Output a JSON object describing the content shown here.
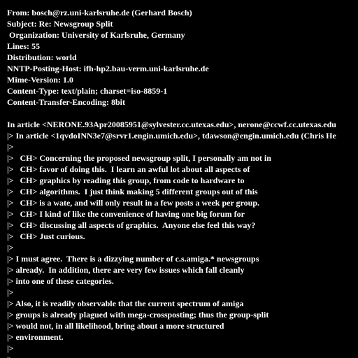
{
  "message": {
    "lines": [
      "From: bosch@rz.uni-karlsruhe.de (Gerhard Bosch)",
      "Subject: Re: Newsgroup Split",
      " Organization: University of Karlsruhe, Germany",
      "Lines: 55",
      "Distribution: world",
      "NNTP-Posting-Host: ifh-hp2.bau-verm.uni-karlsruhe.de",
      "Mime-Version: 1.0",
      "Content-Type: text/plain; charset=iso-8859-1",
      "Content-Transfer-Encoding: 8bit",
      "",
      "In article <NERONE.93Apr20085951@sylvester.cc.utexas.edu>, nerone@ccwf.cc.utexas.edu",
      "|> In article <1qvdoINN3e7@srvr1.engin.umich.edu>, tdawson@engin.umich.edu (Chris He",
      "|>",
      "|>   CH> Concerning the proposed newsgroup split, I personally am not in",
      "|>   CH> favor of doing this.  I learn an awful lot about all aspects of",
      "|>   CH> graphics by reading this group, from code to hardware to",
      "|>   CH> algorithms.  I just think making 5 different groups out of this",
      "|>   CH> is a wate, and will only result in a few posts a week per group.",
      "|>   CH> I kind of like the convenience of having one big forum for",
      "|>   CH> discussing all aspects of graphics.  Anyone else feel this way?",
      "|>   CH> Just curious.",
      "|>",
      "|> I must agree.  There is a dizzying number of c.s.amiga.* newsgroups",
      "|> already.  In addition, there are very few issues which fall cleanly",
      "|> into one of these categories.",
      "|>",
      "|> Also, it is readily observable that the current spectrum of amiga",
      "|> groups is already plagued with mega-crossposting; thus the group-split",
      "|> would not, in all likelihood, bring about a more structured",
      "|> environment.",
      "|>",
      "|>"
    ]
  }
}
